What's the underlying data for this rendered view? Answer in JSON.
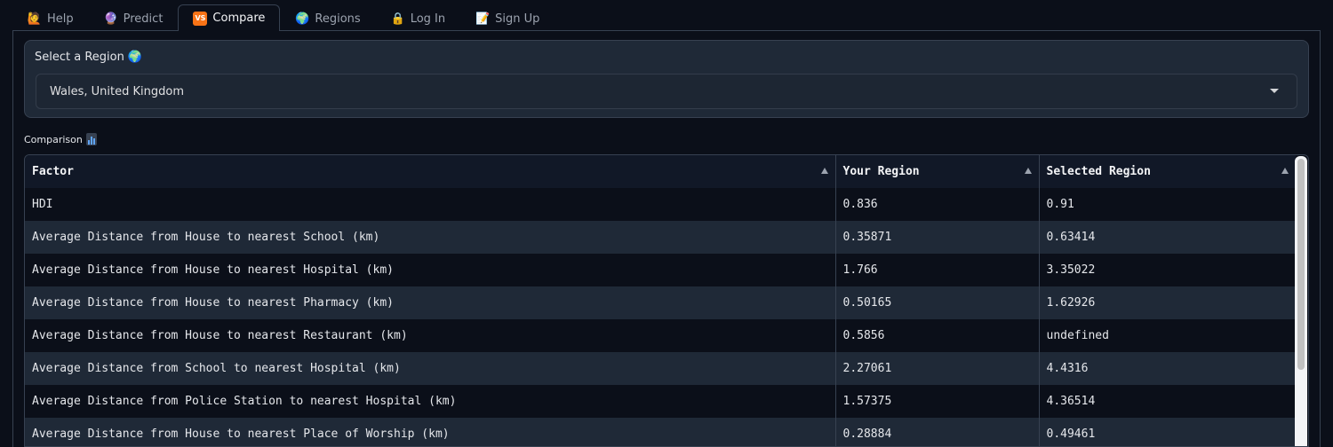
{
  "tabs": [
    {
      "label": "Help",
      "icon": "🙋"
    },
    {
      "label": "Predict",
      "icon": "🔮"
    },
    {
      "label": "Compare",
      "icon": "VS",
      "active": true
    },
    {
      "label": "Regions",
      "icon": "🌍"
    },
    {
      "label": "Log In",
      "icon": "🔒"
    },
    {
      "label": "Sign Up",
      "icon": "📝"
    }
  ],
  "region": {
    "label": "Select a Region",
    "label_icon": "🌍",
    "selected": "Wales, United Kingdom"
  },
  "comparison": {
    "label": "Comparison",
    "columns": [
      "Factor",
      "Your Region",
      "Selected Region"
    ],
    "rows": [
      [
        "HDI",
        "0.836",
        "0.91"
      ],
      [
        "Average Distance from House to nearest School (km)",
        "0.35871",
        "0.63414"
      ],
      [
        "Average Distance from House to nearest Hospital (km)",
        "1.766",
        "3.35022"
      ],
      [
        "Average Distance from House to nearest Pharmacy (km)",
        "0.50165",
        "1.62926"
      ],
      [
        "Average Distance from House to nearest Restaurant (km)",
        "0.5856",
        "undefined"
      ],
      [
        "Average Distance from School to nearest Hospital (km)",
        "2.27061",
        "4.4316"
      ],
      [
        "Average Distance from Police Station to nearest Hospital (km)",
        "1.57375",
        "4.36514"
      ],
      [
        "Average Distance from House to nearest Place of Worship (km)",
        "0.28884",
        "0.49461"
      ]
    ]
  },
  "colors": {
    "background": "#0b0f19",
    "surface": "#1f2937",
    "border": "#374151",
    "accent": "#f97316"
  }
}
